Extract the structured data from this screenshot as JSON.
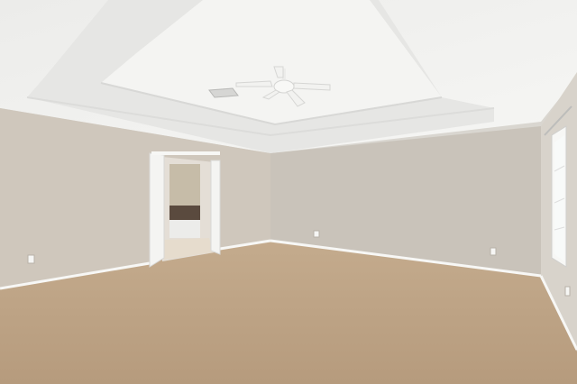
{
  "scene": {
    "subject": "empty-room",
    "colors": {
      "ceiling": "#f2f2f0",
      "ceiling_shadow": "#e4e4e2",
      "wall_left": "#cfc7bc",
      "wall_back": "#c9c3ba",
      "wall_right": "#d8d3cb",
      "carpet": "#c4ab8d",
      "carpet_dark": "#b69b7d",
      "trim": "#f7f7f5",
      "door": "#f4f4f2",
      "bath_tile": "#5a4a3e",
      "window_glass": "#f8faf9"
    }
  }
}
